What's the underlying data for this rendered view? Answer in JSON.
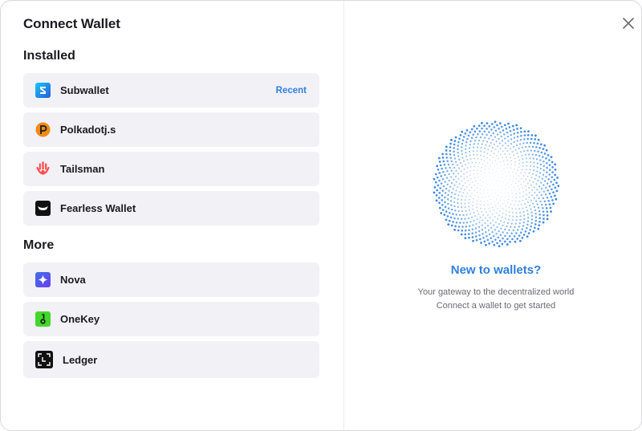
{
  "modal": {
    "title": "Connect Wallet",
    "close_icon": "close-icon"
  },
  "installed": {
    "heading": "Installed",
    "items": [
      {
        "label": "Subwallet",
        "tag": "Recent",
        "icon": "subwallet-icon"
      },
      {
        "label": "Polkadotj.s",
        "icon": "polkadotjs-icon"
      },
      {
        "label": "Tailsman",
        "icon": "talisman-icon"
      },
      {
        "label": "Fearless Wallet",
        "icon": "fearless-wallet-icon"
      }
    ]
  },
  "more": {
    "heading": "More",
    "items": [
      {
        "label": "Nova",
        "icon": "nova-icon"
      },
      {
        "label": "OneKey",
        "icon": "onekey-icon"
      },
      {
        "label": "Ledger",
        "icon": "ledger-icon"
      }
    ]
  },
  "promo": {
    "headline": "New to wallets?",
    "line1": "Your gateway to the decentralized world",
    "line2": "Connect a wallet to get started",
    "illustration": "dotted-circle-illustration"
  },
  "colors": {
    "accent": "#2f80e0",
    "item_bg": "#f2f1f6",
    "text": "#1b1b1f",
    "muted": "#6b6b73"
  }
}
